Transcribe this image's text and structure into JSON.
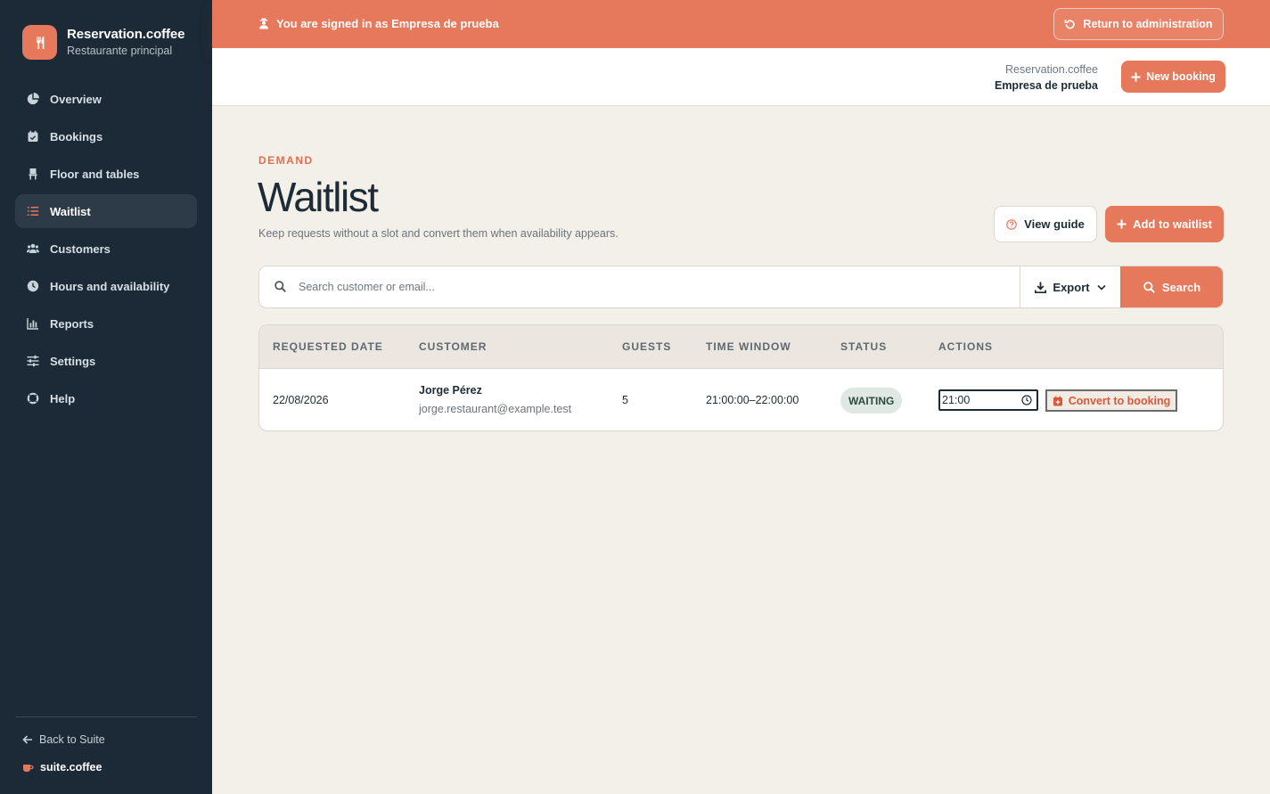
{
  "brand": {
    "title": "Reservation.coffee",
    "subtitle": "Restaurante principal"
  },
  "sidebar": {
    "items": [
      {
        "label": "Overview",
        "icon": "pie-chart-icon",
        "active": false
      },
      {
        "label": "Bookings",
        "icon": "calendar-check-icon",
        "active": false
      },
      {
        "label": "Floor and tables",
        "icon": "chair-icon",
        "active": false
      },
      {
        "label": "Waitlist",
        "icon": "list-ol-icon",
        "active": true
      },
      {
        "label": "Customers",
        "icon": "users-icon",
        "active": false
      },
      {
        "label": "Hours and availability",
        "icon": "clock-icon",
        "active": false
      },
      {
        "label": "Reports",
        "icon": "bar-chart-icon",
        "active": false
      },
      {
        "label": "Settings",
        "icon": "sliders-icon",
        "active": false
      },
      {
        "label": "Help",
        "icon": "life-ring-icon",
        "active": false
      }
    ],
    "back_label": "Back to Suite",
    "suite_label": "suite.coffee"
  },
  "banner": {
    "signed_in_text": "You are signed in as Empresa de prueba",
    "return_label": "Return to administration"
  },
  "header": {
    "app_name": "Reservation.coffee",
    "org_name": "Empresa de prueba",
    "new_booking_label": "New booking"
  },
  "page": {
    "eyebrow": "DEMAND",
    "title": "Waitlist",
    "subtitle": "Keep requests without a slot and convert them when availability appears.",
    "view_guide_label": "View guide",
    "add_label": "Add to waitlist"
  },
  "search": {
    "placeholder": "Search customer or email...",
    "value": "",
    "export_label": "Export",
    "search_label": "Search"
  },
  "table": {
    "columns": [
      "REQUESTED DATE",
      "CUSTOMER",
      "GUESTS",
      "TIME WINDOW",
      "STATUS",
      "ACTIONS"
    ],
    "rows": [
      {
        "requested_date": "22/08/2026",
        "customer_name": "Jorge Pérez",
        "customer_email": "jorge.restaurant@example.test",
        "guests": "5",
        "time_window": "21:00:00–22:00:00",
        "status": "WAITING",
        "time_value": "21:00",
        "convert_label": "Convert to booking"
      }
    ]
  },
  "colors": {
    "accent": "#e6795c",
    "sidebar_bg": "#1b2a36",
    "page_bg": "#f3efe9",
    "status_waiting_bg": "#dfe8e3"
  }
}
